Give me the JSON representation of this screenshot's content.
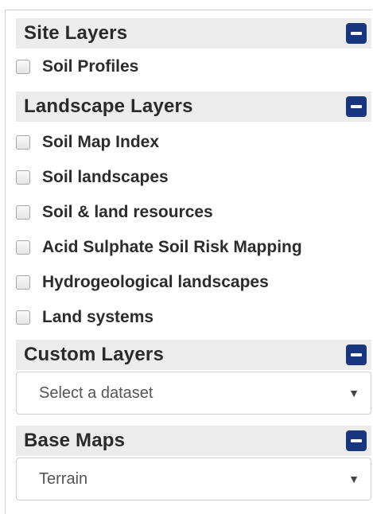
{
  "site_layers": {
    "title": "Site Layers",
    "items": [
      {
        "label": "Soil Profiles",
        "checked": false
      }
    ]
  },
  "landscape_layers": {
    "title": "Landscape Layers",
    "items": [
      {
        "label": "Soil Map Index",
        "checked": false
      },
      {
        "label": "Soil landscapes",
        "checked": false
      },
      {
        "label": "Soil & land resources",
        "checked": false
      },
      {
        "label": "Acid Sulphate Soil Risk Mapping",
        "checked": false
      },
      {
        "label": "Hydrogeological landscapes",
        "checked": false
      },
      {
        "label": "Land systems",
        "checked": false
      }
    ]
  },
  "custom_layers": {
    "title": "Custom Layers",
    "select_value": "Select a dataset"
  },
  "base_maps": {
    "title": "Base Maps",
    "select_value": "Terrain"
  },
  "icons": {
    "collapse": "minus-icon",
    "dropdown": "caret-down-icon"
  },
  "colors": {
    "header_bg": "#ececec",
    "collapse_button": "#1a3580"
  }
}
